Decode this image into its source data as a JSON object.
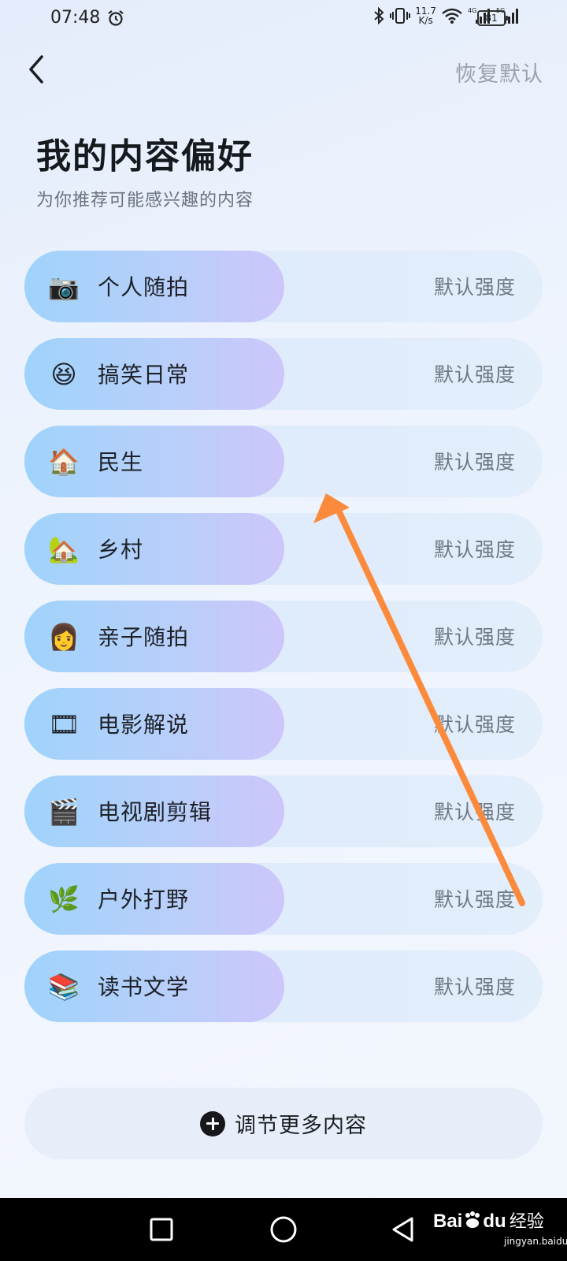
{
  "status_bar": {
    "time": "07:48",
    "net_speed_value": "11.7",
    "net_speed_unit": "K/s",
    "battery": "81",
    "sig1_label": "4G",
    "sig2_label": "5G"
  },
  "header": {
    "back_icon": "chevron-left-icon",
    "restore_label": "恢复默认",
    "title": "我的内容偏好",
    "subtitle": "为你推荐可能感兴趣的内容"
  },
  "preferences": [
    {
      "label": "个人随拍",
      "level": "默认强度",
      "icon": "📷"
    },
    {
      "label": "搞笑日常",
      "level": "默认强度",
      "icon": "😆"
    },
    {
      "label": "民生",
      "level": "默认强度",
      "icon": "🏠"
    },
    {
      "label": "乡村",
      "level": "默认强度",
      "icon": "🏡"
    },
    {
      "label": "亲子随拍",
      "level": "默认强度",
      "icon": "👩"
    },
    {
      "label": "电影解说",
      "level": "默认强度",
      "icon": "🎞"
    },
    {
      "label": "电视剧剪辑",
      "level": "默认强度",
      "icon": "🎬"
    },
    {
      "label": "户外打野",
      "level": "默认强度",
      "icon": "🌿"
    },
    {
      "label": "读书文学",
      "level": "默认强度",
      "icon": "📚"
    }
  ],
  "adjust_more": {
    "label": "调节更多内容"
  },
  "watermark": {
    "brand": "Bai",
    "brand_suffix": "du",
    "cn": "经验",
    "url": "jingyan.baidu.com"
  },
  "colors": {
    "fill_start": "#9fd3fb",
    "fill_end": "#cdc6fa",
    "row_bg": "#dbe9fb",
    "arrow": "#fb8a3c"
  }
}
